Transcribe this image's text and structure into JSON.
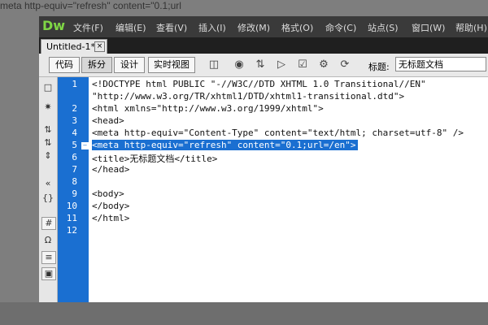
{
  "background_caption": "meta http-equiv=\"refresh\" content=\"0.1;url",
  "app": {
    "logo": "Dw"
  },
  "menu": [
    "文件(F)",
    "编辑(E)",
    "查看(V)",
    "插入(I)",
    "修改(M)",
    "格式(O)",
    "命令(C)",
    "站点(S)",
    "窗口(W)",
    "帮助(H)"
  ],
  "document_tab": {
    "name": "Untitled-1*",
    "close": "×"
  },
  "views": {
    "code": "代码",
    "split": "拆分",
    "design": "设计",
    "live": "实时视图"
  },
  "toolbar_icons": [
    "file-management-icon",
    "preview-browser-icon",
    "debug-icon",
    "visual-aids-icon",
    "validate-icon",
    "check-compat-icon",
    "refresh-icon"
  ],
  "title_field": {
    "label": "标题:",
    "value": "无标题文档"
  },
  "line_numbers": [
    "1",
    "2",
    "3",
    "4",
    "5",
    "6",
    "7",
    "8",
    "9",
    "10",
    "11",
    "12"
  ],
  "code_lines": [
    "<!DOCTYPE html PUBLIC \"-//W3C//DTD XHTML 1.0 Transitional//EN\"",
    "\"http://www.w3.org/TR/xhtml1/DTD/xhtml1-transitional.dtd\">",
    "<html xmlns=\"http://www.w3.org/1999/xhtml\">",
    "<head>",
    "<meta http-equiv=\"Content-Type\" content=\"text/html; charset=utf-8\" />",
    "<meta http-equiv=\"refresh\" content=\"0.1;url=/en\">",
    "<title>无标题文档</title>",
    "</head>",
    "",
    "<body>",
    "</body>",
    "</html>"
  ],
  "selected_line": 5,
  "colors": {
    "gutter": "#1a6fd1",
    "selection": "#1a6fd1",
    "menubar": "#3a3a3a",
    "logo": "#7fd645"
  }
}
